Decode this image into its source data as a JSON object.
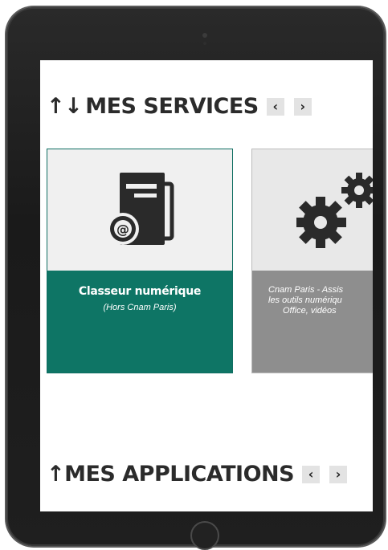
{
  "services": {
    "title_arrows": "↑↓",
    "title": "MES SERVICES",
    "prev_label": "‹",
    "next_label": "›",
    "cards": [
      {
        "title": "Classeur numérique",
        "subtitle": "(Hors Cnam Paris)",
        "icon": "folder-email-icon",
        "accent": "#0e7565"
      },
      {
        "desc_lines": [
          "Cnam Paris - Assis",
          "les outils numériqu",
          "Office, vidéos"
        ],
        "icon": "gears-icon",
        "accent": "#8e8e8e"
      }
    ]
  },
  "applications": {
    "title_arrows": "↑",
    "title": "MES APPLICATIONS",
    "prev_label": "‹",
    "next_label": "›"
  }
}
